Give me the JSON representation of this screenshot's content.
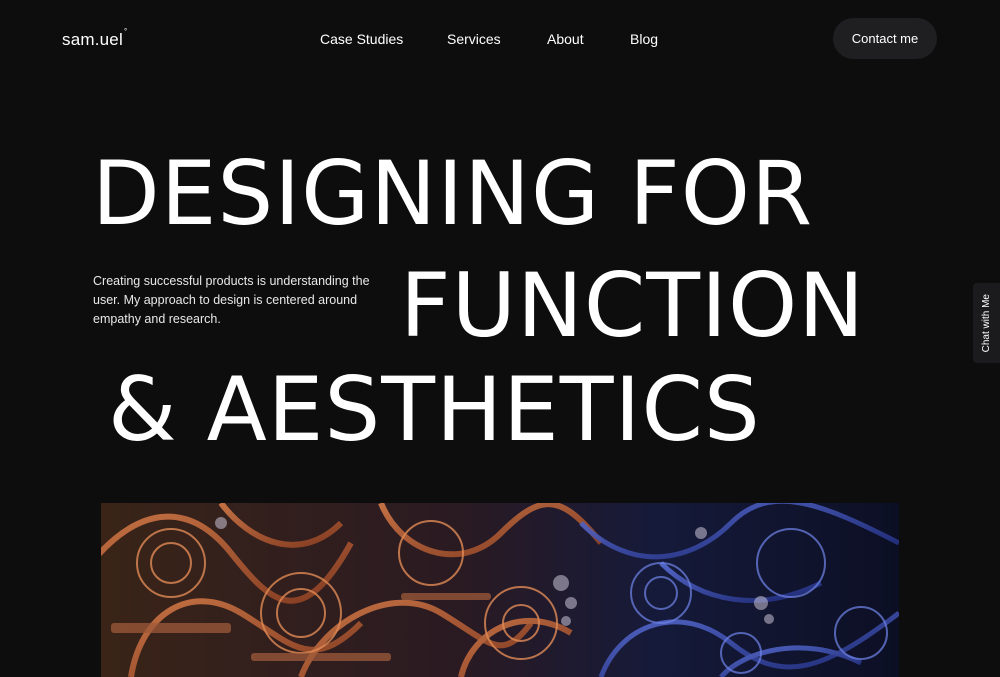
{
  "brand": {
    "name": "sam.uel",
    "mark": "°"
  },
  "nav": {
    "items": [
      {
        "label": "Case Studies"
      },
      {
        "label": "Services"
      },
      {
        "label": "About"
      },
      {
        "label": "Blog"
      }
    ]
  },
  "contact_button": {
    "label": "Contact me"
  },
  "hero": {
    "line1": "DESIGNING FOR",
    "line2": "FUNCTION",
    "line3": "& AESTHETICS",
    "tagline": "Creating successful products is understanding the user. My approach to design is centered around empathy and research."
  },
  "chat_tab": {
    "label": "Chat with Me"
  },
  "colors": {
    "background": "#0d0d0d",
    "button_bg": "#1f1f22",
    "text": "#ffffff",
    "art_orange": "#c0643a",
    "art_blue": "#2c3f9e"
  }
}
